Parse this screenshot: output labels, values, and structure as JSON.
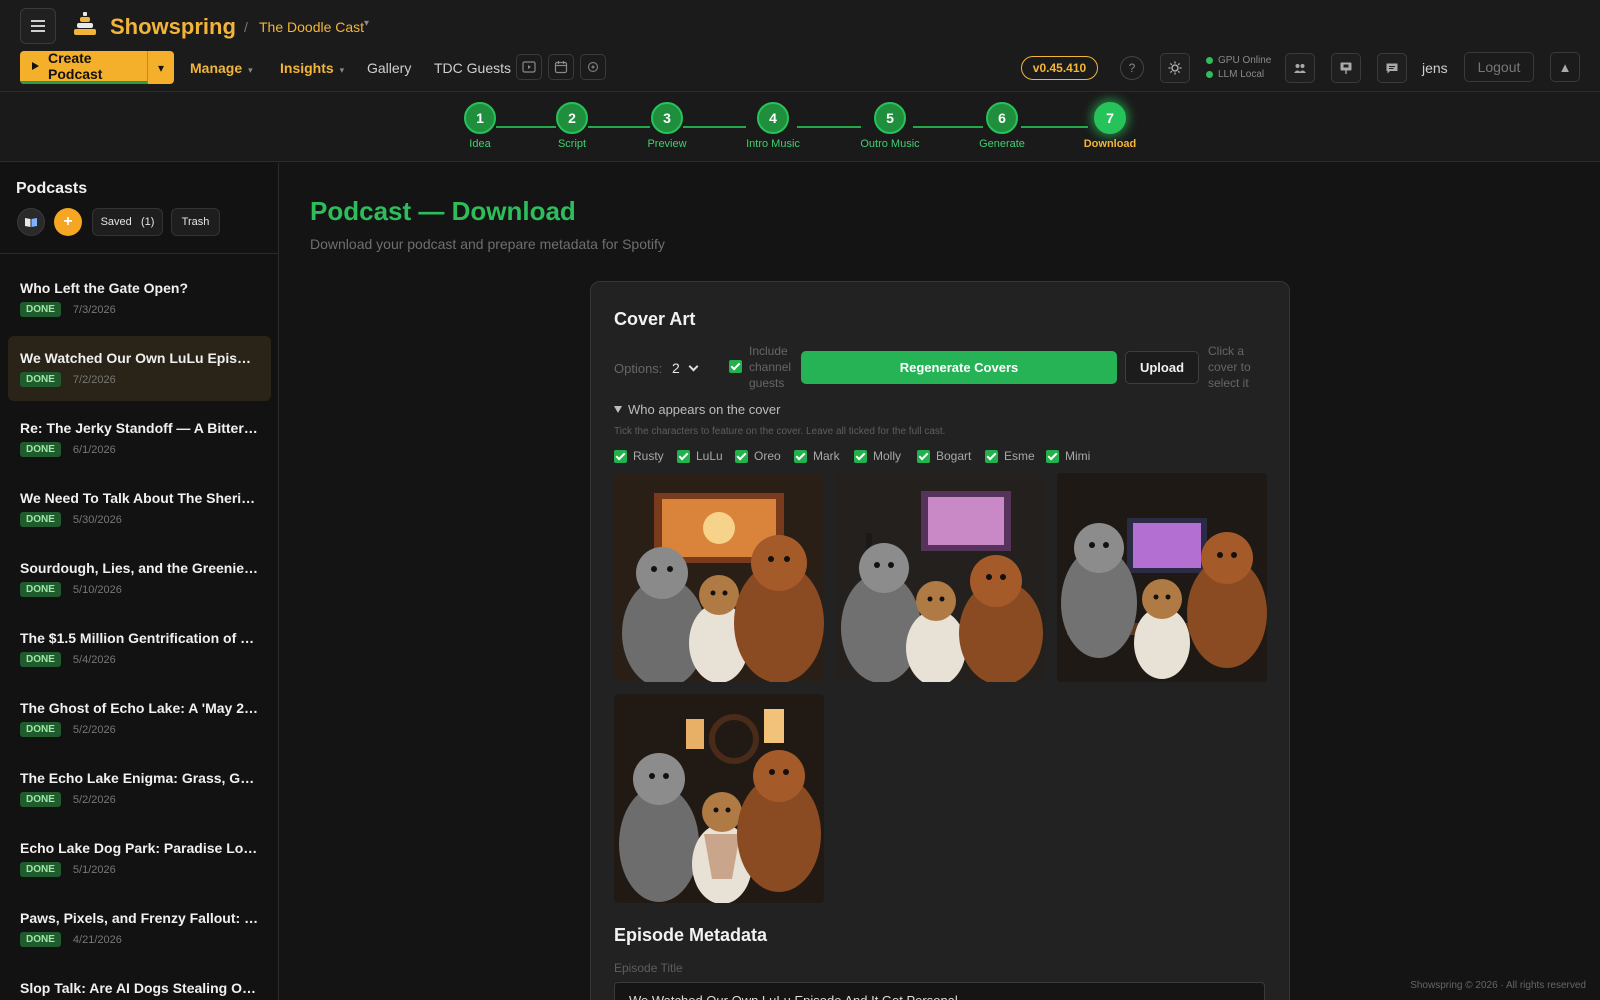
{
  "app": {
    "brand": "Showspring",
    "breadcrumb": "The Doodle Cast",
    "breadcrumb_sep": "/"
  },
  "toolbar": {
    "create_label": "Create Podcast",
    "nav": [
      "Manage",
      "Insights",
      "Gallery",
      "TDC Guests"
    ],
    "version": "v0.45.410",
    "help": "?",
    "status": [
      "GPU Online",
      "LLM Local"
    ],
    "user": "jens",
    "logout": "Logout"
  },
  "steps": [
    {
      "n": "1",
      "label": "Idea"
    },
    {
      "n": "2",
      "label": "Script"
    },
    {
      "n": "3",
      "label": "Preview"
    },
    {
      "n": "4",
      "label": "Intro Music"
    },
    {
      "n": "5",
      "label": "Outro Music"
    },
    {
      "n": "6",
      "label": "Generate"
    },
    {
      "n": "7",
      "label": "Download"
    }
  ],
  "sidebar": {
    "title": "Podcasts",
    "saved_label": "Saved",
    "saved_count": "(1)",
    "trash_label": "Trash",
    "items": [
      {
        "title": "Who Left the Gate Open?",
        "status": "DONE",
        "date": "7/3/2026"
      },
      {
        "title": "We Watched Our Own LuLu Episod...",
        "status": "DONE",
        "date": "7/2/2026"
      },
      {
        "title": "Re: The Jerky Standoff — A Bitter Fl...",
        "status": "DONE",
        "date": "6/1/2026"
      },
      {
        "title": "We Need To Talk About The Sheriff'...",
        "status": "DONE",
        "date": "5/30/2026"
      },
      {
        "title": "Sourdough, Lies, and the Greenie C...",
        "status": "DONE",
        "date": "5/10/2026"
      },
      {
        "title": "The $1.5 Million Gentrification of Ec...",
        "status": "DONE",
        "date": "5/4/2026"
      },
      {
        "title": "The Ghost of Echo Lake: A 'May 202...",
        "status": "DONE",
        "date": "5/2/2026"
      },
      {
        "title": "The Echo Lake Enigma: Grass, Gates...",
        "status": "DONE",
        "date": "5/2/2026"
      },
      {
        "title": "Echo Lake Dog Park: Paradise Lost ...",
        "status": "DONE",
        "date": "5/1/2026"
      },
      {
        "title": "Paws, Pixels, and Frenzy Fallout: Do...",
        "status": "DONE",
        "date": "4/21/2026"
      },
      {
        "title": "Slop Talk: Are AI Dogs Stealing Our ...",
        "status": "DONE",
        "date": ""
      }
    ]
  },
  "main": {
    "title": "Podcast — Download",
    "subtitle": "Download your podcast and prepare metadata for Spotify",
    "cover": {
      "heading": "Cover Art",
      "options_label": "Options:",
      "options_value": "2",
      "include_label": "Include channel guests",
      "regen_label": "Regenerate Covers",
      "upload_label": "Upload",
      "click_hint": "Click a cover to select it",
      "who_label": "Who appears on the cover",
      "who_hint": "Tick the characters to feature on the cover. Leave all ticked for the full cast.",
      "characters": [
        "Rusty",
        "LuLu",
        "Oreo",
        "Mark",
        "Molly",
        "Bogart",
        "Esme",
        "Mimi"
      ]
    },
    "metadata": {
      "heading": "Episode Metadata",
      "title_label": "Episode Title",
      "title_value": "We Watched Our Own LuLu Episode And It Got Personal"
    }
  },
  "footer": "Showspring © 2026 · All rights reserved",
  "colors": {
    "accent_gold": "#f2b53a",
    "accent_green": "#25b356",
    "badge_bg": "#1f5b2c"
  }
}
